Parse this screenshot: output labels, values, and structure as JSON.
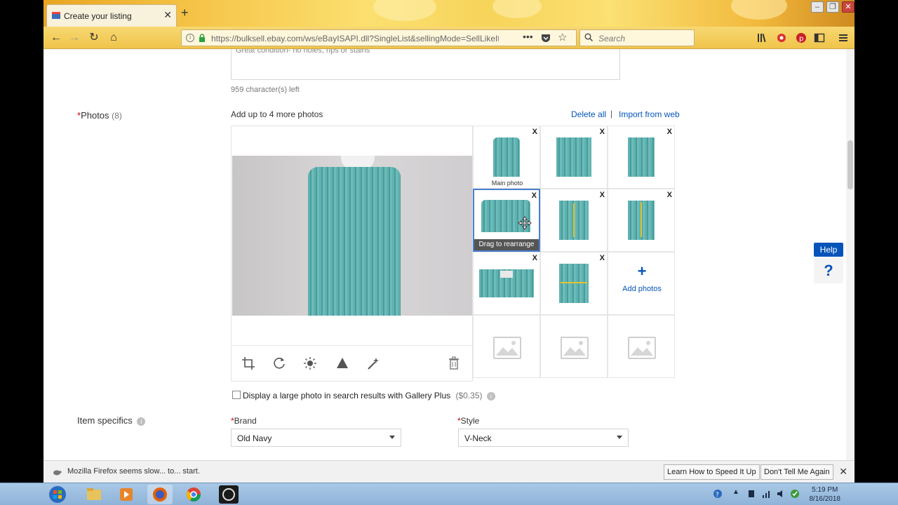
{
  "browser": {
    "tab_title": "Create your listing",
    "url": "https://bulksell.ebay.com/ws/eBayISAPI.dll?SingleList&sellingMode=SellLikeIt",
    "search_placeholder": "Search"
  },
  "description": {
    "cut_text": "Great condition- no holes, rips or stains",
    "chars_left": "959 character(s) left"
  },
  "photos": {
    "label": "Photos",
    "count": "(8)",
    "add_more": "Add up to 4 more photos",
    "delete_all": "Delete all",
    "separator": "|",
    "import_web": "Import from web",
    "main_photo_caption": "Main photo",
    "drag_caption": "Drag to rearrange",
    "add_photos": "Add photos",
    "delete_glyph": "X"
  },
  "gallery_plus": {
    "label": "Display a large photo in search results with Gallery Plus",
    "price": "($0.35)"
  },
  "item_specifics": {
    "label": "Item specifics",
    "brand_label": "Brand",
    "brand_value": "Old Navy",
    "style_label": "Style",
    "style_value": "V-Neck"
  },
  "help": {
    "label": "Help",
    "icon": "?"
  },
  "notification": {
    "message": "Mozilla Firefox seems slow... to... start.",
    "btn_speed": "Learn How to Speed It Up",
    "btn_dont": "Don't Tell Me Again"
  },
  "taskbar": {
    "time": "5:19 PM",
    "date": "8/16/2018"
  },
  "colors": {
    "link": "#0654ba",
    "required": "#cc0000",
    "sweater": "#5fb2b0"
  }
}
